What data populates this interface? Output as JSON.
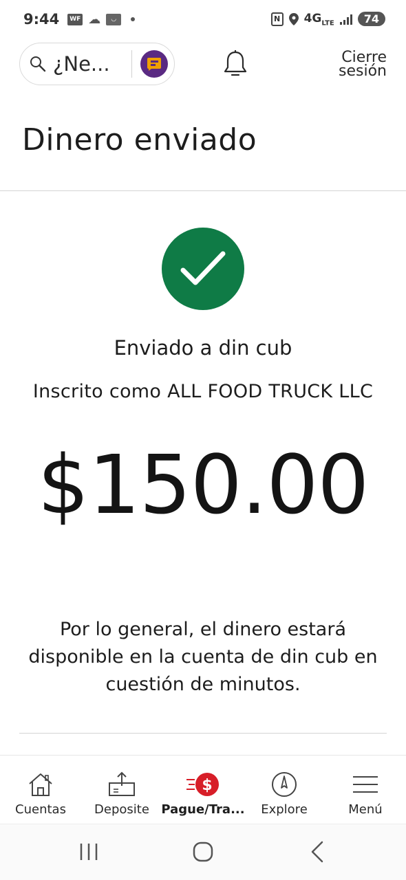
{
  "status_bar": {
    "time": "9:44",
    "app_badge": "WF",
    "network": "4G",
    "network_sub": "LTE",
    "battery": "74"
  },
  "header": {
    "search_placeholder": "¿Ne...",
    "signout_line1": "Cierre",
    "signout_line2": "sesión"
  },
  "page": {
    "title": "Dinero enviado"
  },
  "confirmation": {
    "sent_to": "Enviado a din cub",
    "enrolled_as": "Inscrito como ALL FOOD TRUCK LLC",
    "amount": "$150.00",
    "note": "Por lo general, el dinero estará disponible en la cuenta de din cub en cuestión de minutos.",
    "success_color": "#0f7b46"
  },
  "bottom_nav": {
    "items": [
      {
        "label": "Cuentas",
        "icon": "house-icon"
      },
      {
        "label": "Deposite",
        "icon": "deposit-icon"
      },
      {
        "label": "Pague/Tra...",
        "icon": "pay-transfer-icon",
        "active": true
      },
      {
        "label": "Explore",
        "icon": "compass-icon"
      },
      {
        "label": "Menú",
        "icon": "hamburger-menu-icon"
      }
    ],
    "accent_color": "#d71e28"
  },
  "system_nav": {
    "icons": [
      "recents-icon",
      "home-icon",
      "back-icon"
    ]
  }
}
